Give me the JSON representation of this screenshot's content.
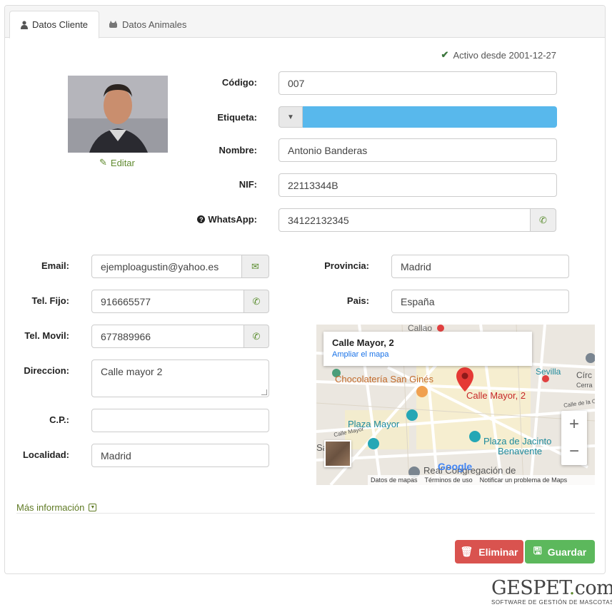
{
  "tabs": [
    {
      "label": "Datos Cliente",
      "icon": "user-icon"
    },
    {
      "label": "Datos Animales",
      "icon": "paw-icon"
    }
  ],
  "status": {
    "text": "Activo desde 2001-12-27"
  },
  "photo": {
    "edit_label": "Editar"
  },
  "fields": {
    "codigo": {
      "label": "Código:",
      "value": "007"
    },
    "etiqueta": {
      "label": "Etiqueta:",
      "color": "#58b8ec"
    },
    "nombre": {
      "label": "Nombre:",
      "value": "Antonio Banderas"
    },
    "nif": {
      "label": "NIF:",
      "value": "22113344B"
    },
    "whatsapp": {
      "label": "WhatsApp:",
      "value": "34122132345"
    },
    "email": {
      "label": "Email:",
      "value": "ejemploagustin@yahoo.es"
    },
    "tel_fijo": {
      "label": "Tel. Fijo:",
      "value": "916665577"
    },
    "tel_movil": {
      "label": "Tel. Movil:",
      "value": "677889966"
    },
    "direccion": {
      "label": "Direccion:",
      "value": "Calle mayor 2"
    },
    "cp": {
      "label": "C.P.:",
      "value": ""
    },
    "localidad": {
      "label": "Localidad:",
      "value": "Madrid"
    },
    "provincia": {
      "label": "Provincia:",
      "value": "Madrid"
    },
    "pais": {
      "label": "Pais:",
      "value": "España"
    }
  },
  "map": {
    "card_title": "Calle Mayor, 2",
    "card_link": "Ampliar el mapa",
    "labels": {
      "callao": "Callao",
      "chocolateria": "Chocolatería San Ginés",
      "calle_mayor": "Calle Mayor, 2",
      "plaza_mayor": "Plaza Mayor",
      "plaza_jacinto": "Plaza de Jacinto",
      "benavente": "Benavente",
      "sevilla": "Sevilla",
      "circ": "Círc",
      "cerra": "Cerra",
      "real": "Real Congregación de",
      "san_miguel": "Sa      uel",
      "calle_de_la_c": "Calle de la C",
      "calle_mayor_small": "Calle Mayor"
    },
    "footer": {
      "datos": "Datos de mapas",
      "terminos": "Términos de uso",
      "notificar": "Notificar un problema de Maps"
    },
    "google": "Google"
  },
  "more_info": "Más información",
  "buttons": {
    "eliminar": "Eliminar",
    "guardar": "Guardar"
  },
  "logo": {
    "gespet": "GESPET",
    "dot": ".",
    "com": "com",
    "tagline": "SOFTWARE DE GESTIÓN DE MASCOTAS"
  },
  "colors": {
    "accent_green": "#5f8a2e",
    "danger": "#d9534f",
    "success": "#5cb85c",
    "label_blue": "#58b8ec"
  }
}
